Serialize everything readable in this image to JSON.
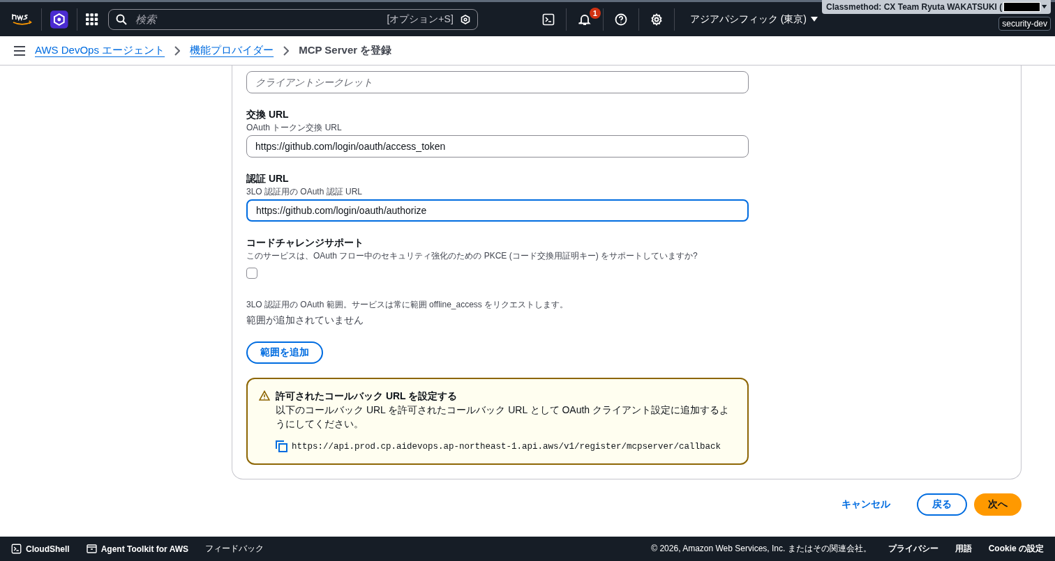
{
  "top_nav": {
    "search": {
      "placeholder": "検索",
      "shortcut": "[オプション+S]"
    },
    "notification_count": "1",
    "region": "アジアパシフィック (東京)",
    "account": "Classmethod: CX Team Ryuta WAKATSUKI (",
    "account_alias": "security-dev"
  },
  "breadcrumbs": [
    {
      "label": "AWS DevOps エージェント",
      "link": true
    },
    {
      "label": "機能プロバイダー",
      "link": true
    },
    {
      "label": "MCP Server を登録",
      "link": false
    }
  ],
  "form": {
    "fields": [
      {
        "kind": "input",
        "placeholder": "クライアントシークレット",
        "focused": false
      },
      {
        "kind": "input",
        "label": "交換 URL",
        "description": "OAuth トークン交換 URL",
        "value": "https://github.com/login/oauth/access_token",
        "focused": false
      },
      {
        "kind": "input",
        "label": "認証 URL",
        "description": "3LO 認証用の OAuth 認証 URL",
        "value": "https://github.com/login/oauth/authorize",
        "focused": true
      },
      {
        "kind": "checkbox",
        "label": "コードチャレンジサポート",
        "description": "このサービスは、OAuth フロー中のセキュリティ強化のための PKCE (コード交換用証明キー) をサポートしていますか?",
        "checked": false
      },
      {
        "kind": "scopes",
        "description": "3LO 認証用の OAuth 範囲。サービスは常に範囲 offline_access をリクエストします。",
        "empty_text": "範囲が追加されていません",
        "button": "範囲を追加"
      }
    ],
    "alert": {
      "title": "許可されたコールバック URL を設定する",
      "body": "以下のコールバック URL を許可されたコールバック URL として OAuth クライアント設定に追加するようにしてください。",
      "url": "https://api.prod.cp.aidevops.ap-northeast-1.api.aws/v1/register/mcpserver/callback"
    }
  },
  "actions": [
    {
      "label": "キャンセル",
      "kind": "link"
    },
    {
      "label": "戻る",
      "kind": "normal"
    },
    {
      "label": "次へ",
      "kind": "primary"
    }
  ],
  "footer": {
    "left": [
      {
        "label": "CloudShell",
        "kind": "terminal"
      },
      {
        "label": "Agent Toolkit for AWS",
        "kind": "window"
      },
      {
        "label": "フィードバック",
        "kind": "text"
      }
    ],
    "copyright": "© 2026, Amazon Web Services, Inc. またはその関連会社。",
    "links": [
      "プライバシー",
      "用語",
      "Cookie の設定"
    ]
  }
}
